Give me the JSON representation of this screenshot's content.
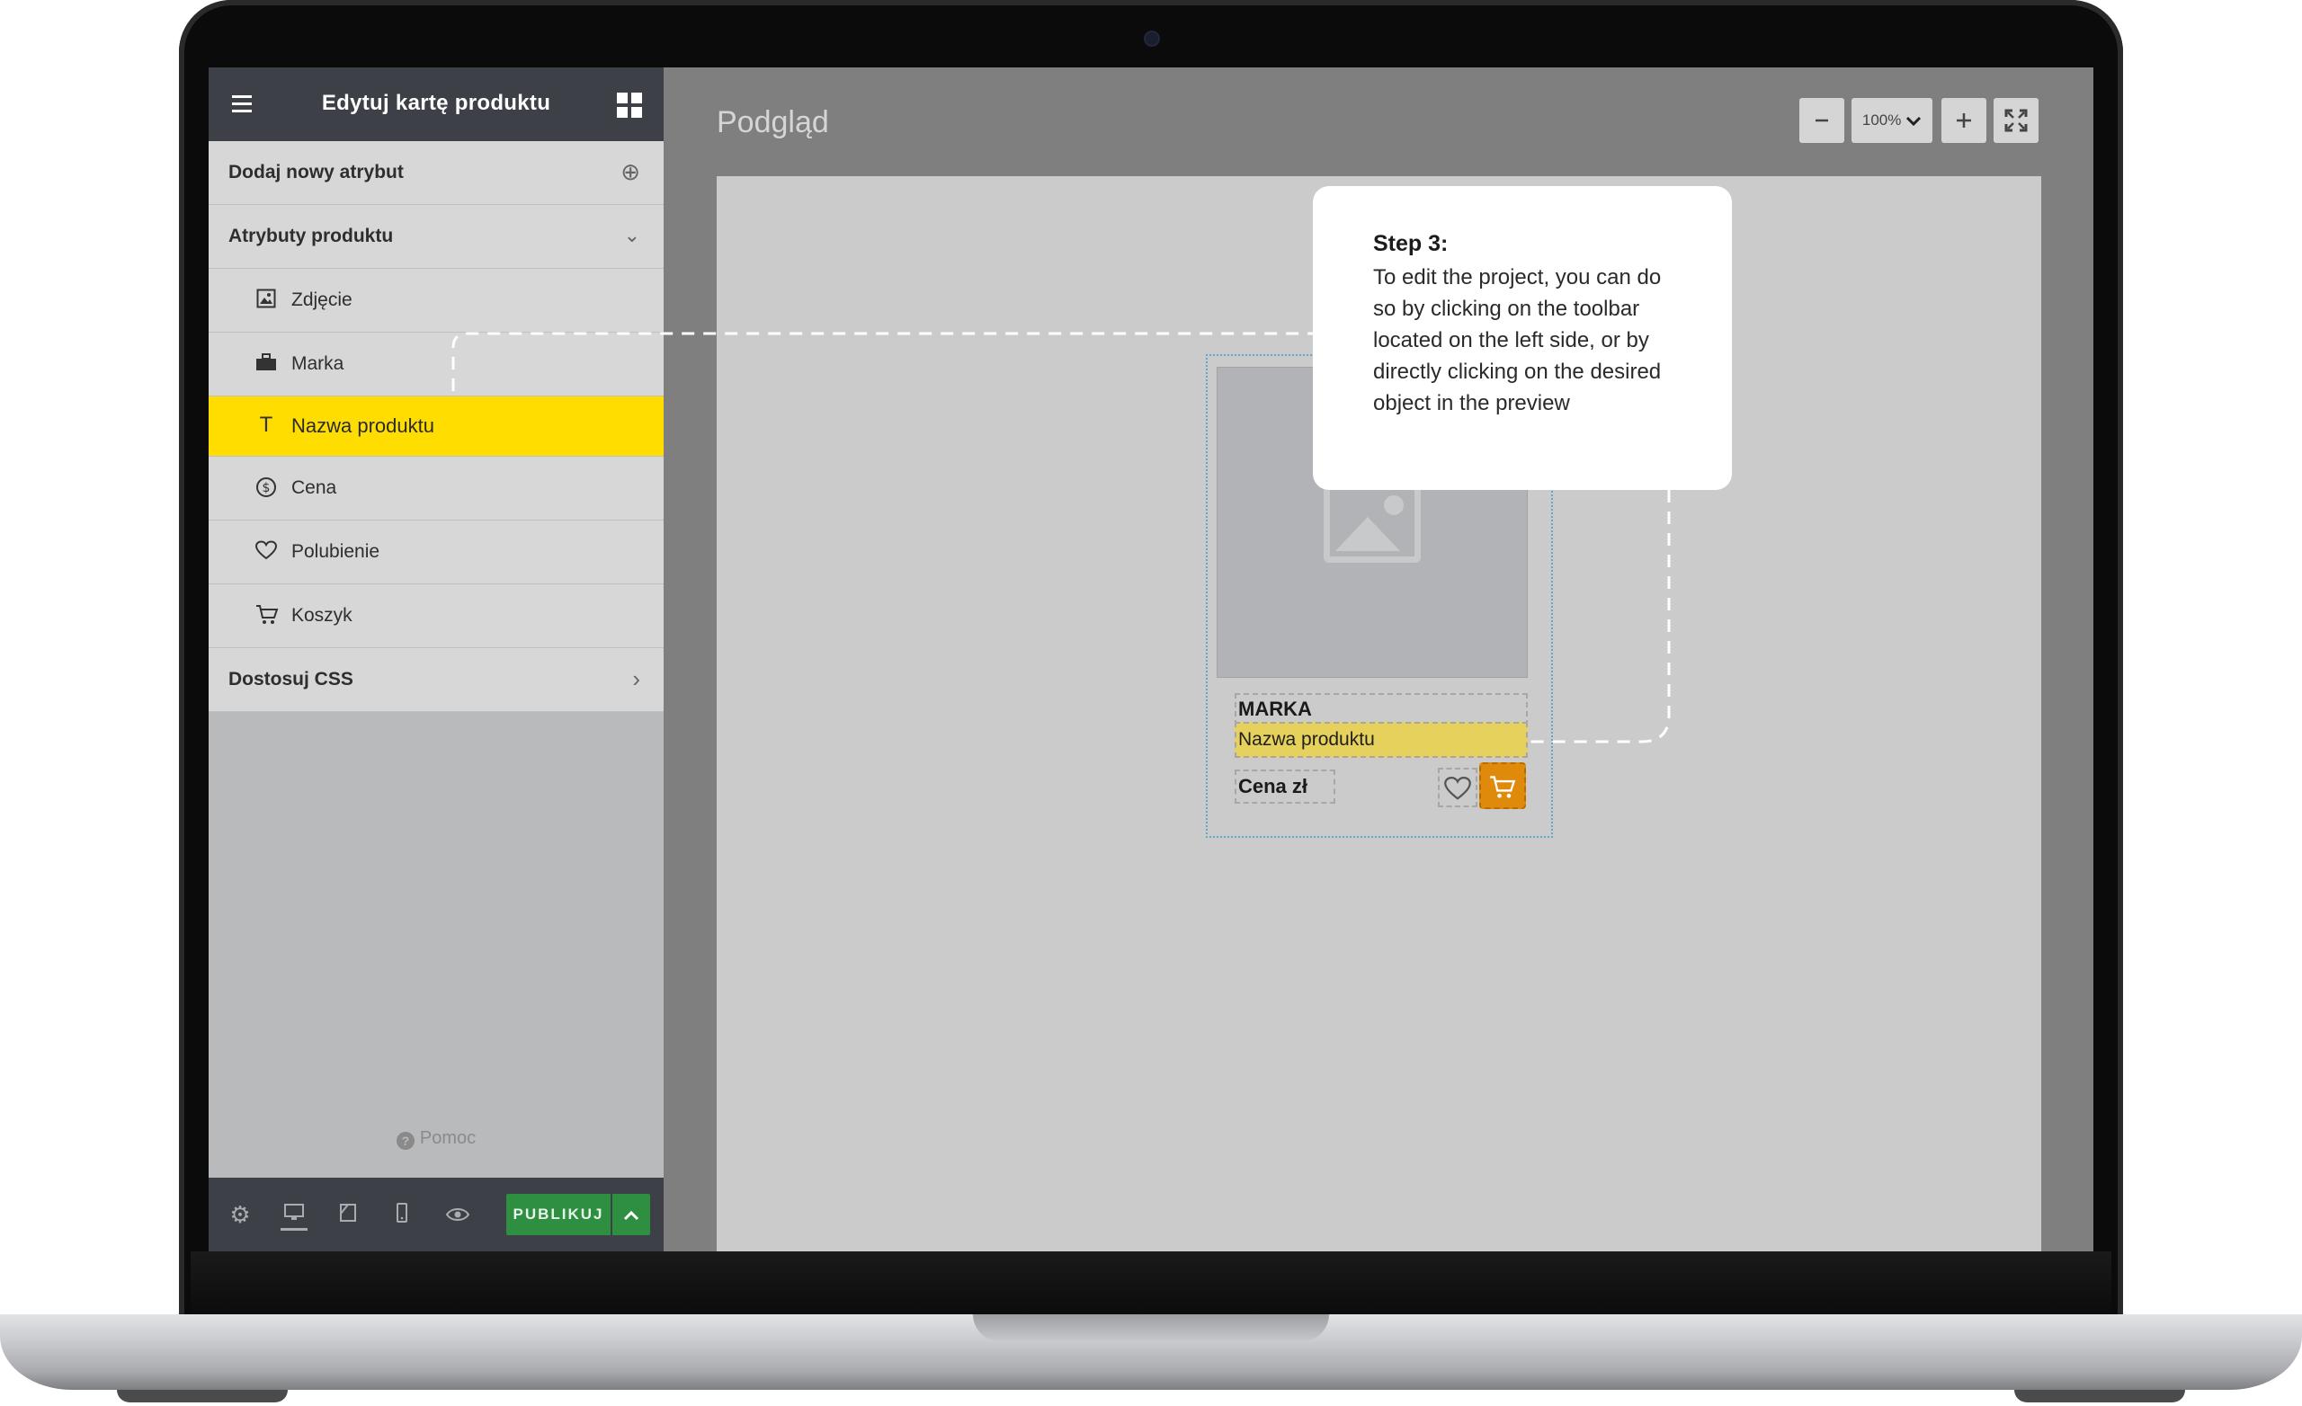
{
  "sidebar": {
    "title": "Edytuj kartę produktu",
    "sections": {
      "add_attribute": "Dodaj nowy atrybut",
      "product_attributes": "Atrybuty produktu",
      "customize_css": "Dostosuj CSS"
    },
    "items": [
      {
        "label": "Zdjęcie",
        "icon": "image-icon"
      },
      {
        "label": "Marka",
        "icon": "briefcase-icon"
      },
      {
        "label": "Nazwa produktu",
        "icon": "text-icon"
      },
      {
        "label": "Cena",
        "icon": "dollar-icon"
      },
      {
        "label": "Polubienie",
        "icon": "heart-icon"
      },
      {
        "label": "Koszyk",
        "icon": "cart-icon"
      }
    ],
    "active_item": "Nazwa produktu",
    "help": "Pomoc",
    "publish_label": "PUBLIKUJ"
  },
  "preview": {
    "title": "Podgląd",
    "zoom": "100%",
    "card": {
      "brand": "MARKA",
      "name": "Nazwa produktu",
      "price": "Cena zł"
    }
  },
  "callout": {
    "step": "Step 3:",
    "text": "To edit the project, you can do so by clicking on the toolbar located on the left side, or by directly clicking on the desired object in the preview"
  },
  "colors": {
    "accent": "#ffdd00",
    "publish": "#2d8f3f",
    "cart": "#e08a0c",
    "header": "#3d4147"
  }
}
